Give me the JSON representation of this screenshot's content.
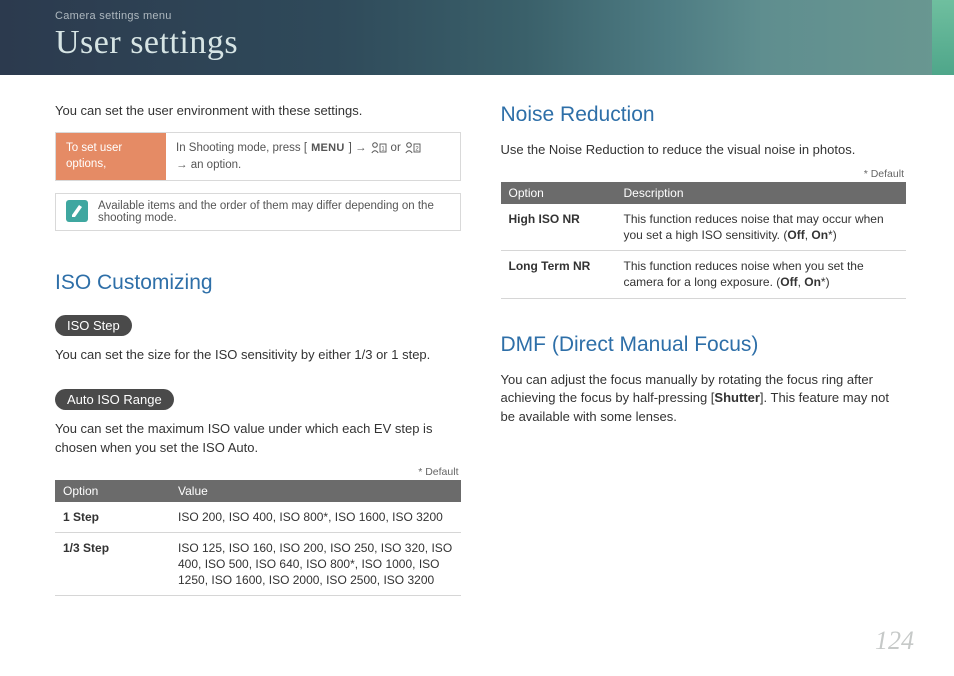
{
  "header": {
    "breadcrumb": "Camera settings menu",
    "title": "User settings"
  },
  "left": {
    "intro": "You can set the user environment with these settings.",
    "gridbox": {
      "label": "To set user options,",
      "prefix": "In Shooting mode, press [",
      "menu": "MENU",
      "mid1": "] → ",
      "mid2": " or ",
      "suffix": " → an option."
    },
    "note": "Available items and the order of them may differ depending on the shooting mode.",
    "iso_heading": "ISO Customizing",
    "iso_step_pill": "ISO Step",
    "iso_step_text": "You can set the size for the ISO sensitivity by either 1/3 or 1 step.",
    "auto_iso_pill": "Auto ISO Range",
    "auto_iso_text": "You can set the maximum ISO value under which each EV step is chosen when you set the ISO Auto.",
    "default_note": "* Default",
    "iso_table": {
      "headers": [
        "Option",
        "Value"
      ],
      "rows": [
        {
          "k": "1 Step",
          "v": "ISO 200, ISO 400, ISO 800*, ISO 1600, ISO 3200"
        },
        {
          "k": "1/3 Step",
          "v": "ISO 125, ISO 160, ISO 200, ISO 250, ISO 320, ISO 400, ISO 500, ISO 640, ISO 800*, ISO 1000, ISO 1250, ISO 1600, ISO 2000, ISO 2500, ISO 3200"
        }
      ]
    }
  },
  "right": {
    "nr_heading": "Noise Reduction",
    "nr_intro": "Use the Noise Reduction to reduce the visual noise in photos.",
    "default_note": "* Default",
    "nr_table": {
      "headers": [
        "Option",
        "Description"
      ],
      "rows": [
        {
          "k": "High ISO NR",
          "pre": "This function reduces noise that may occur when you set a high ISO sensitivity. (",
          "off": "Off",
          "sep": ", ",
          "on": "On",
          "post": "*)"
        },
        {
          "k": "Long Term NR",
          "pre": "This function reduces noise when you set the camera for a long exposure. (",
          "off": "Off",
          "sep": ", ",
          "on": "On",
          "post": "*)"
        }
      ]
    },
    "dmf_heading": "DMF (Direct Manual Focus)",
    "dmf_pre": "You can adjust the focus manually by rotating the focus ring after achieving the focus by half-pressing [",
    "dmf_shutter": "Shutter",
    "dmf_post": "]. This feature may not be available with some lenses."
  },
  "page_number": "124"
}
